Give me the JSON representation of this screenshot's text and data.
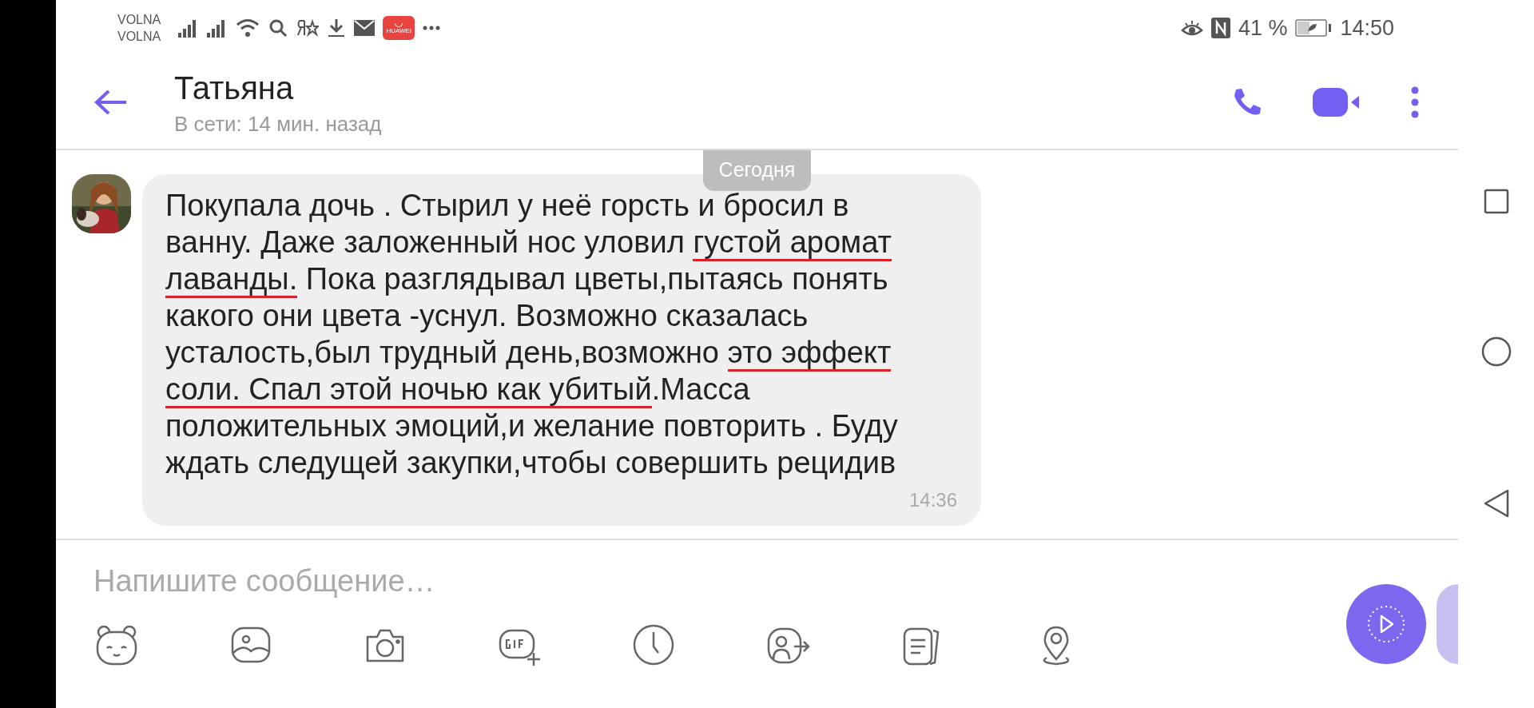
{
  "status_bar": {
    "carriers": [
      "VOLNA",
      "VOLNA"
    ],
    "app_badge": "HUAWEI",
    "battery_percent": "41 %",
    "time": "14:50"
  },
  "header": {
    "title": "Татьяна",
    "subtitle": "В сети: 14 мин. назад"
  },
  "date_label": "Сегодня",
  "messages": [
    {
      "lines": [
        [
          {
            "text": "Покупала дочь . Стырил у неё горсть и бросил в",
            "underlined": false
          }
        ],
        [
          {
            "text": "ванну. Даже заложенный нос уловил ",
            "underlined": false
          },
          {
            "text": "густой аромат",
            "underlined": true
          }
        ],
        [
          {
            "text": "лаванды.",
            "underlined": true
          },
          {
            "text": " Пока разглядывал цветы,пытаясь понять",
            "underlined": false
          }
        ],
        [
          {
            "text": "какого они цвета -уснул. Возможно сказалась",
            "underlined": false
          }
        ],
        [
          {
            "text": "усталость,был трудный день,возможно ",
            "underlined": false
          },
          {
            "text": "это эффект",
            "underlined": true
          }
        ],
        [
          {
            "text": "соли. Спал этой ночью как убитый",
            "underlined": true
          },
          {
            "text": ".Масса",
            "underlined": false
          }
        ],
        [
          {
            "text": "положительных эмоций,и желание повторить . Буду",
            "underlined": false
          }
        ],
        [
          {
            "text": "ждать следущей закупки,чтобы совершить рецидив",
            "underlined": false
          }
        ]
      ],
      "time": "14:36"
    }
  ],
  "composer": {
    "placeholder": "Напишите сообщение…"
  }
}
